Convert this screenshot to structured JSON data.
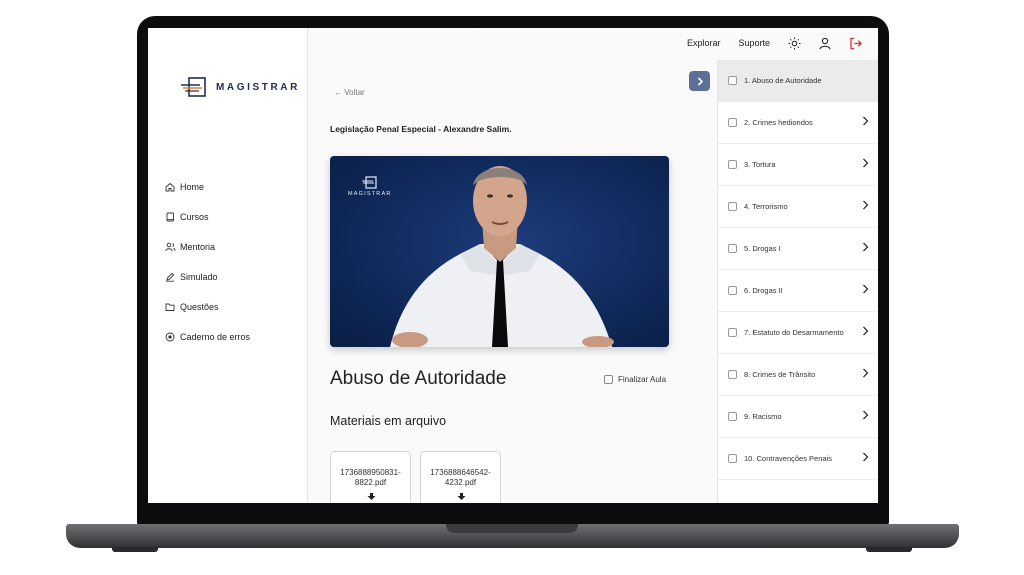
{
  "app": {
    "logo_text": "MAGISTRAR"
  },
  "sidebar": {
    "items": [
      {
        "label": "Home",
        "icon": "home-icon"
      },
      {
        "label": "Cursos",
        "icon": "book-icon"
      },
      {
        "label": "Mentoria",
        "icon": "users-icon"
      },
      {
        "label": "Simulado",
        "icon": "pen-icon"
      },
      {
        "label": "Questões",
        "icon": "folder-icon"
      },
      {
        "label": "Caderno de erros",
        "icon": "circle-dot-icon"
      }
    ]
  },
  "topbar": {
    "links": [
      "Explorar",
      "Suporte"
    ],
    "icons": [
      "sun-icon",
      "user-icon",
      "logout-icon"
    ],
    "logout_color": "#e0252c"
  },
  "main": {
    "back_label": "Voltar",
    "course_title": "Legislação Penal Especial - Alexandre Salim.",
    "video_logo": "MAGISTRAR",
    "lesson_title": "Abuso de Autoridade",
    "finalize_label": "Finalizar Aula",
    "materials_title": "Materiais em arquivo",
    "files": [
      {
        "name_line1": "1736888950831-",
        "name_line2": "8822.pdf"
      },
      {
        "name_line1": "1736888646542-",
        "name_line2": "4232.pdf"
      }
    ]
  },
  "lessons": [
    {
      "label": "1. Abuso de Autoridade",
      "active": true
    },
    {
      "label": "2. Crimes hediondos"
    },
    {
      "label": "3. Tortura"
    },
    {
      "label": "4. Terrorismo"
    },
    {
      "label": "5. Drogas I"
    },
    {
      "label": "6. Drogas II"
    },
    {
      "label": "7. Estatuto do Desarmamento"
    },
    {
      "label": "8. Crimes de Trânsito"
    },
    {
      "label": "9. Racismo"
    },
    {
      "label": "10. Contravenções Penais"
    }
  ],
  "colors": {
    "accent": "#5c6f97",
    "video_bg": "#102a5c",
    "logo_navy": "#1f2f52",
    "logo_orange": "#d9822b"
  }
}
